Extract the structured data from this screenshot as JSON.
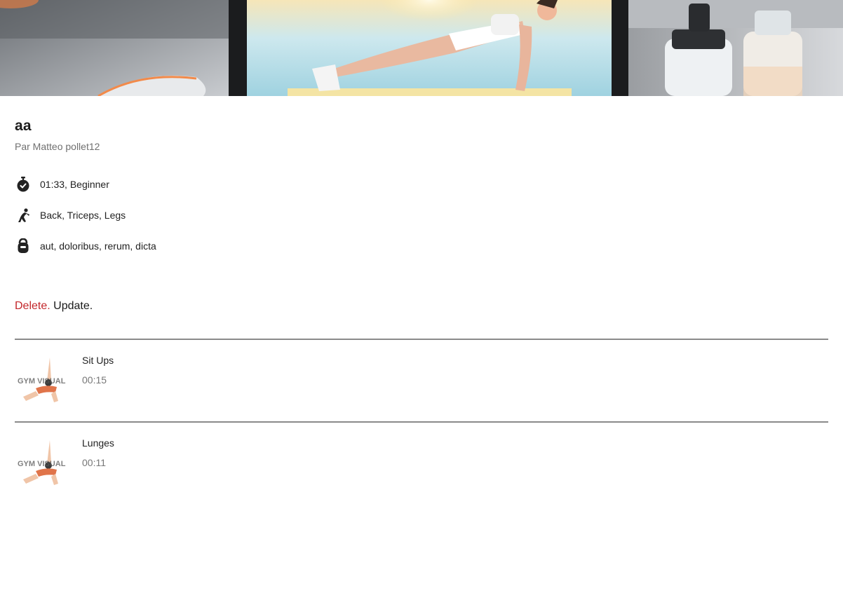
{
  "workout": {
    "title": "aa",
    "author": "Par Matteo pollet12",
    "duration_level": "01:33, Beginner",
    "muscles": "Back, Triceps, Legs",
    "equipment": "aut, doloribus, rerum, dicta"
  },
  "actions": {
    "delete_label": "Delete.",
    "update_label": "Update."
  },
  "exercises": [
    {
      "name": "Sit Ups",
      "time": "00:15",
      "thumb_text": "GYM VISUAL"
    },
    {
      "name": "Lunges",
      "time": "00:11",
      "thumb_text": "GYM VISUAL"
    }
  ],
  "colors": {
    "delete": "#c3272b",
    "divider": "#8a8a8a",
    "muted": "#707070"
  },
  "icons": {
    "duration": "stopwatch-icon",
    "muscles": "stretching-person-icon",
    "equipment": "kettlebell-icon"
  }
}
